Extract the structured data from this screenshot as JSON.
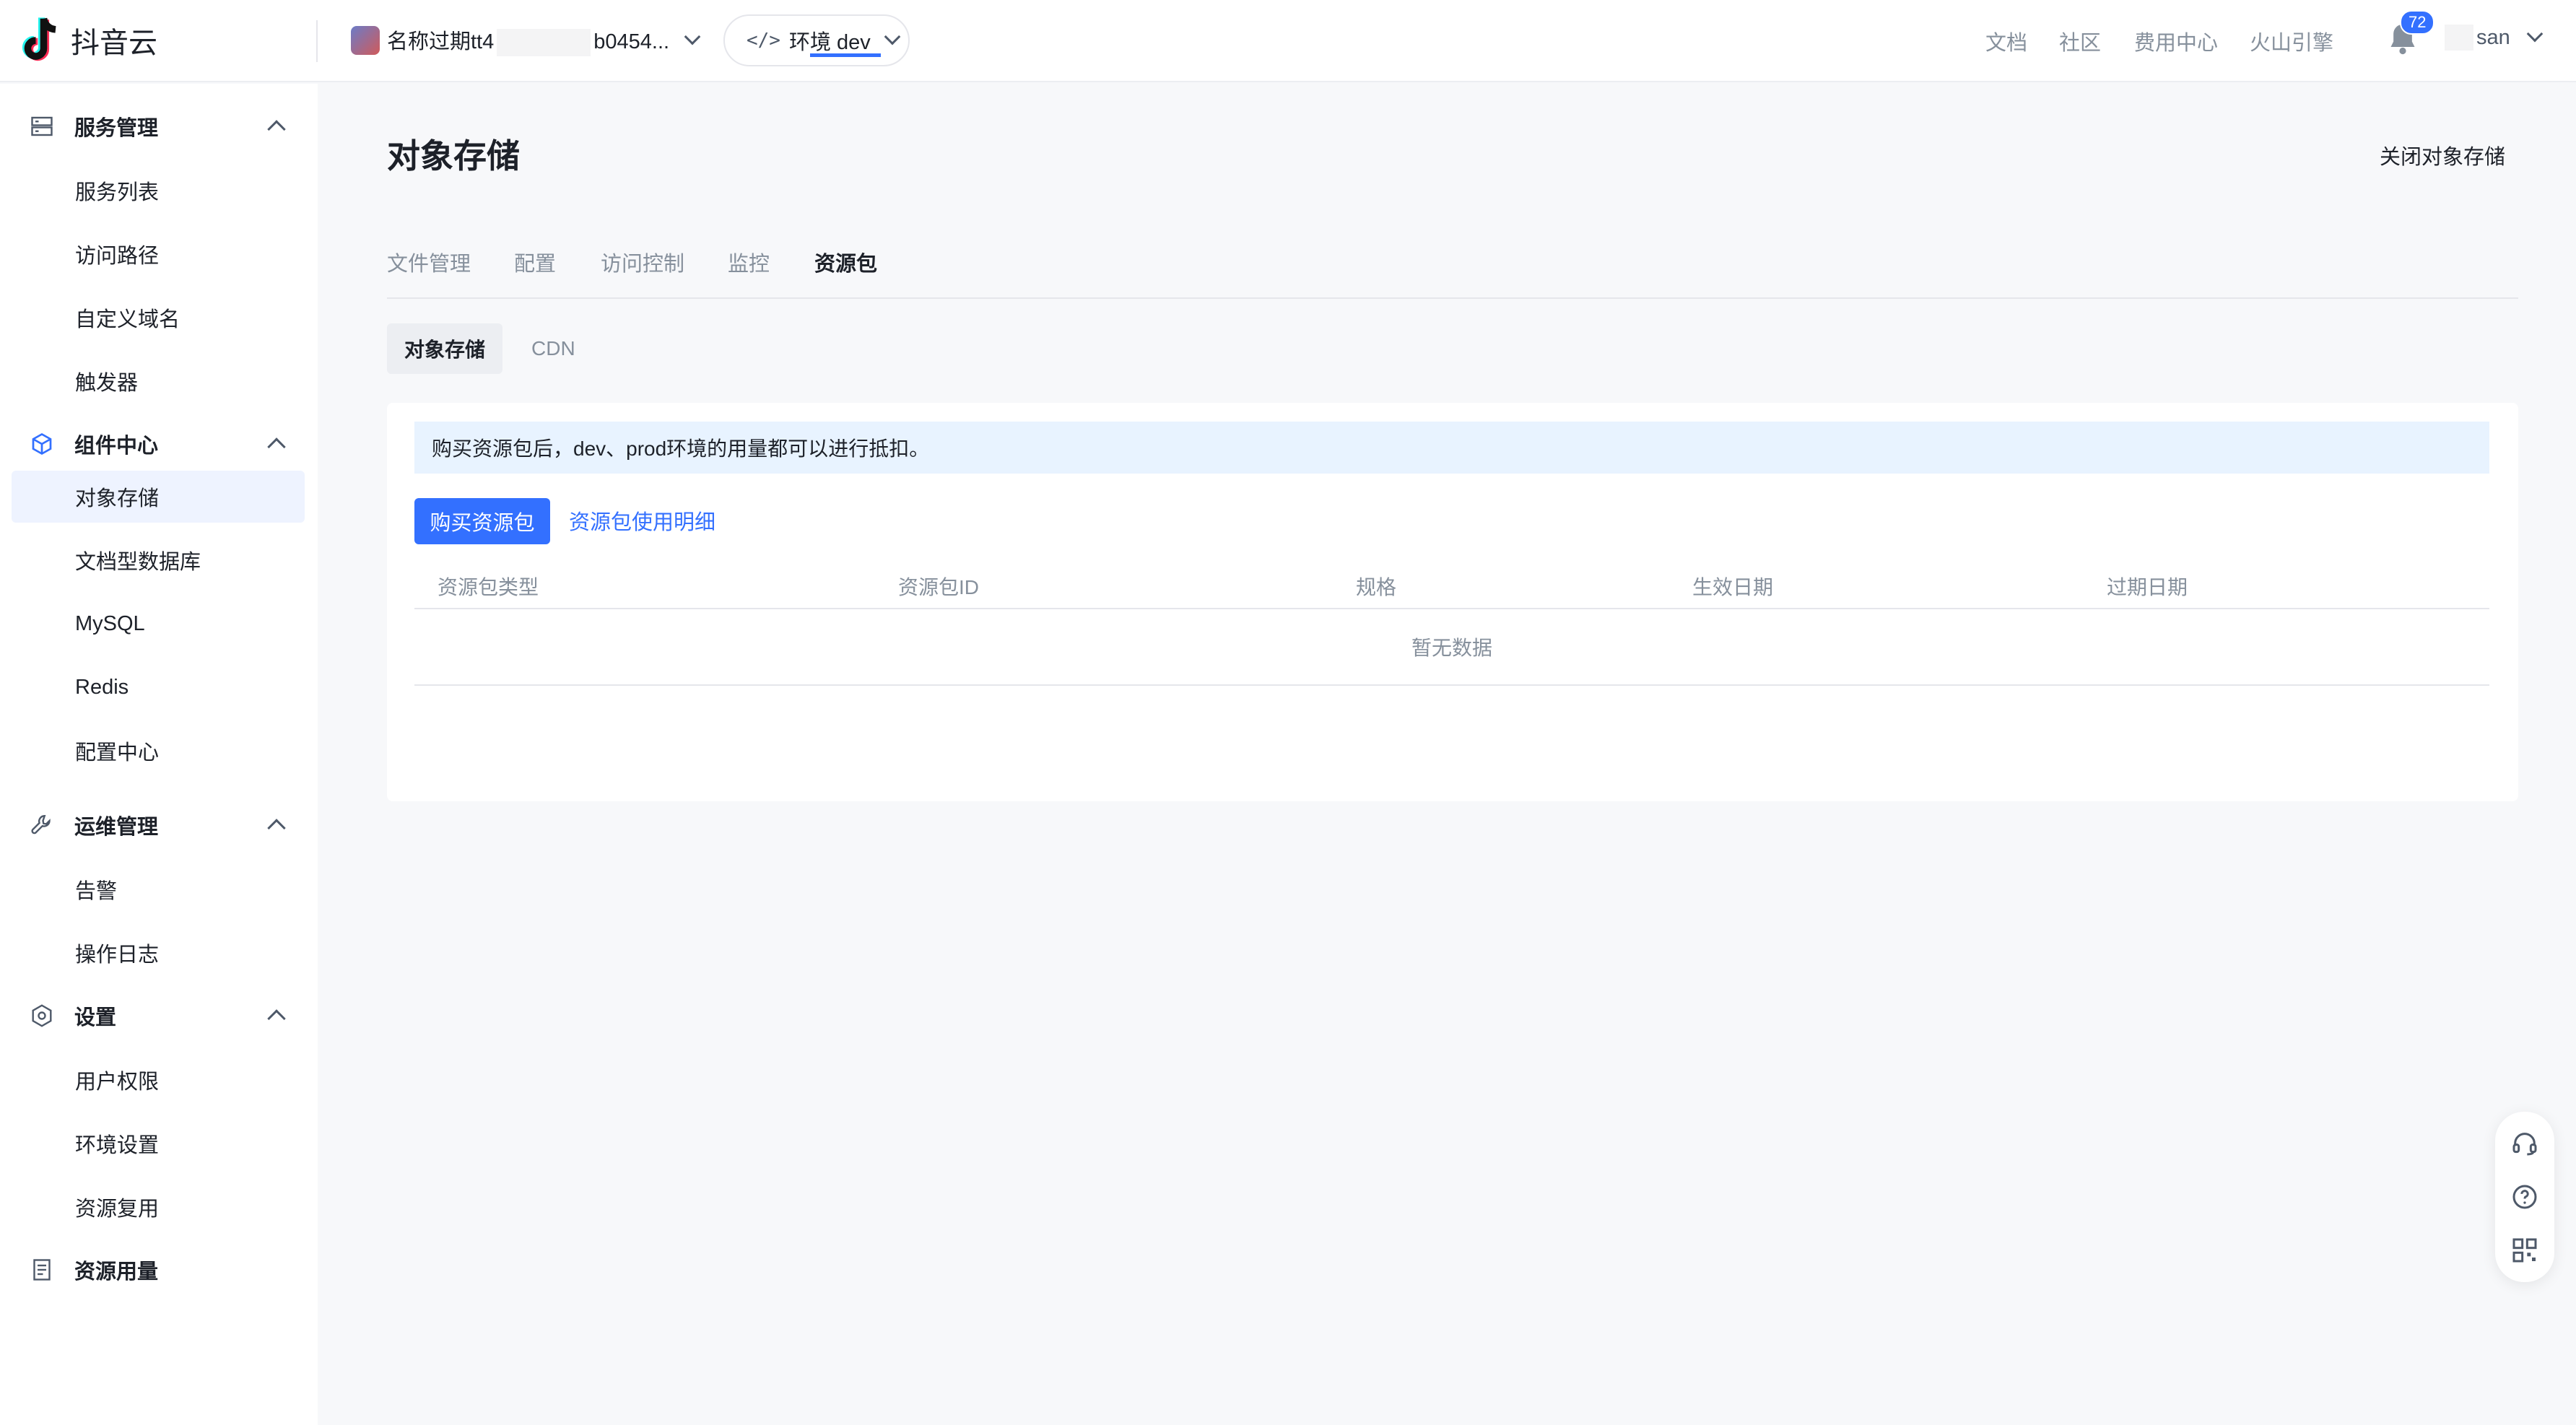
{
  "brand": {
    "name": "抖音云"
  },
  "header": {
    "app_name_prefix": "名称过期tt4",
    "app_name_suffix": "b0454...",
    "env_label": "环境 dev",
    "nav": [
      "文档",
      "社区",
      "费用中心",
      "火山引擎"
    ],
    "notification_count": "72",
    "user_suffix": "san"
  },
  "sidebar": {
    "groups": [
      {
        "label": "服务管理",
        "items": [
          "服务列表",
          "访问路径",
          "自定义域名",
          "触发器"
        ]
      },
      {
        "label": "组件中心",
        "items": [
          "对象存储",
          "文档型数据库",
          "MySQL",
          "Redis",
          "配置中心"
        ]
      },
      {
        "label": "运维管理",
        "items": [
          "告警",
          "操作日志"
        ]
      },
      {
        "label": "设置",
        "items": [
          "用户权限",
          "环境设置",
          "资源复用"
        ]
      },
      {
        "label": "资源用量",
        "items": []
      }
    ],
    "active_item": "对象存储"
  },
  "main": {
    "title": "对象存储",
    "close_action": "关闭对象存储",
    "tabs": [
      "文件管理",
      "配置",
      "访问控制",
      "监控",
      "资源包"
    ],
    "active_tab": "资源包",
    "subtabs": [
      "对象存储",
      "CDN"
    ],
    "active_subtab": "对象存储",
    "notice": "购买资源包后，dev、prod环境的用量都可以进行抵扣。",
    "buy_button": "购买资源包",
    "usage_link": "资源包使用明细",
    "table": {
      "columns": [
        "资源包类型",
        "资源包ID",
        "规格",
        "生效日期",
        "过期日期"
      ],
      "empty_text": "暂无数据"
    }
  },
  "colors": {
    "accent": "#3370ff",
    "notice_bg": "#e8f3ff",
    "active_item_bg": "#eef3ff"
  }
}
